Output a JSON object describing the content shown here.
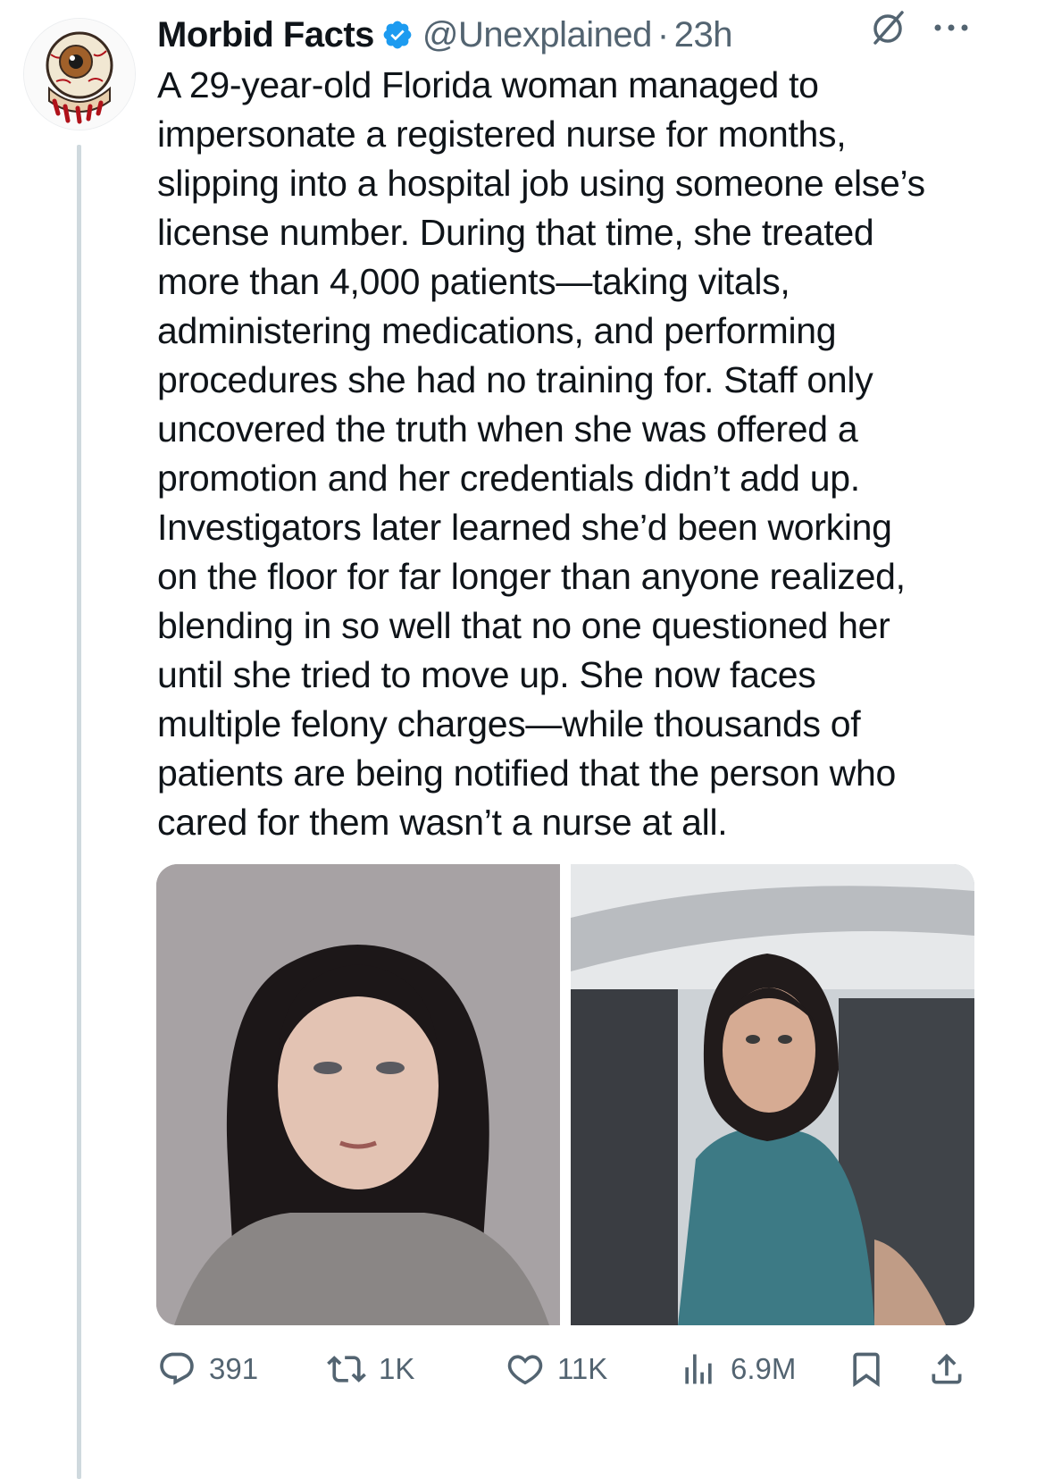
{
  "tweet": {
    "author_name": "Morbid Facts",
    "author_handle": "@Unexplained",
    "separator": "·",
    "time": "23h",
    "avatar_icon": "eyeball-icon",
    "verified_icon": "verified-badge-icon",
    "text": "A 29-year-old Florida woman managed to\nimpersonate a registered nurse for months,\nslipping into a hospital job using someone else’s\nlicense number. During that time, she treated\nmore than 4,000 patients—taking vitals,\nadministering medications, and performing\nprocedures she had no training for. Staff only\nuncovered the truth when she was offered a\npromotion and her credentials didn’t add up.\nInvestigators later learned she’d been working\non the floor for far longer than anyone realized,\nblending in so well that no one questioned her\nuntil she tried to move up. She now faces\nmultiple felony charges—while thousands of\npatients are being notified that the person who\ncared for them wasn’t a nurse at all."
  },
  "actions": {
    "replies": "391",
    "reposts": "1K",
    "likes": "11K",
    "views": "6.9M"
  },
  "colors": {
    "text": "#0f1419",
    "secondary": "#536471",
    "verified": "#1d9bf0",
    "thread_line": "#cfd9de"
  }
}
